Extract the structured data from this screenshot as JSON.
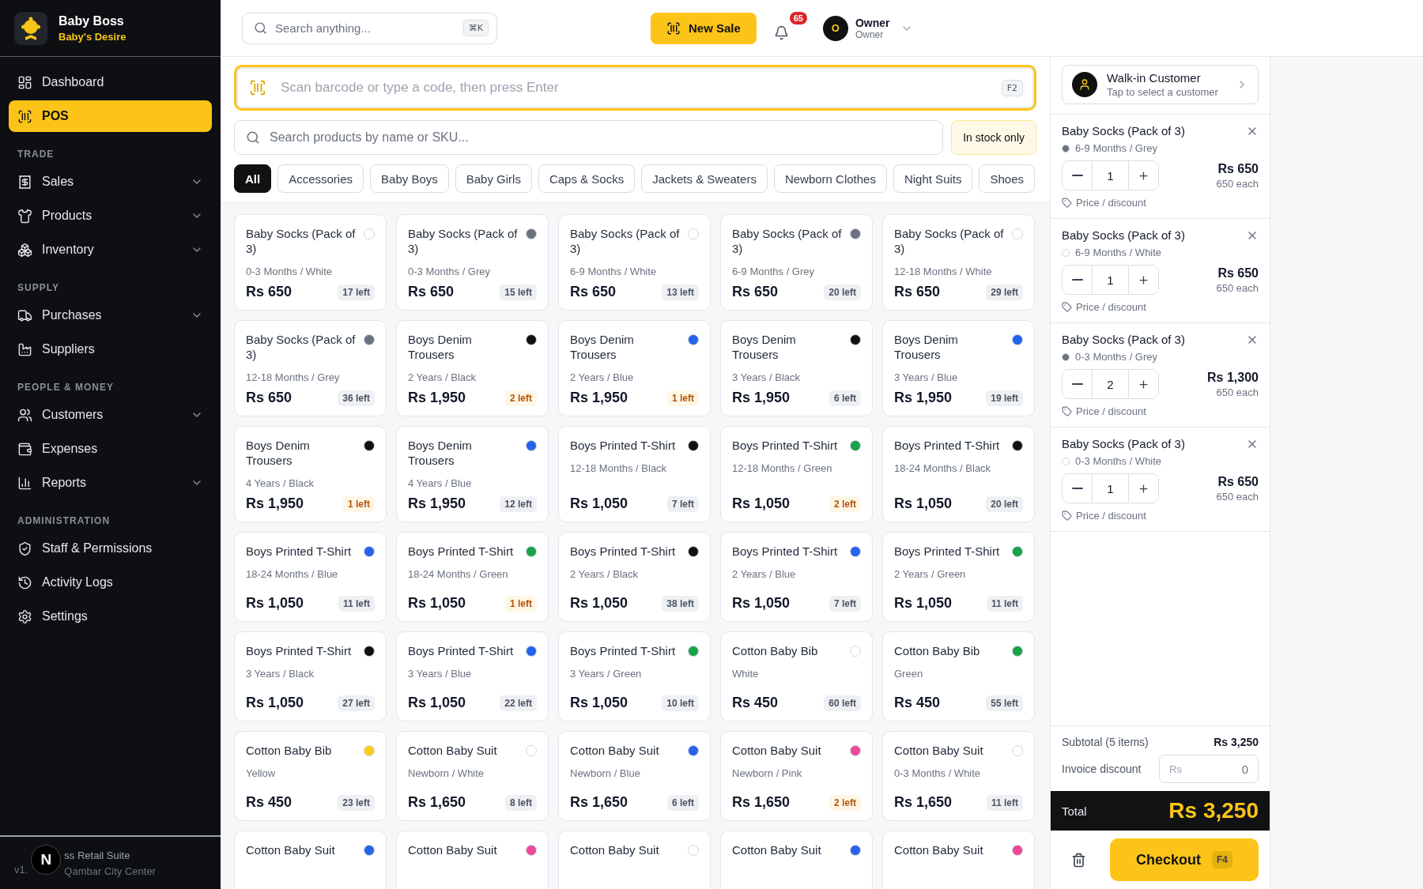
{
  "brand": {
    "name": "Baby Boss",
    "tagline": "Baby's Desire"
  },
  "nav": [
    {
      "items": [
        {
          "label": "Dashboard",
          "selected": false
        },
        {
          "label": "POS",
          "selected": true
        }
      ]
    },
    {
      "heading": "TRADE",
      "items": [
        {
          "label": "Sales",
          "selected": false,
          "expanded": false
        },
        {
          "label": "Products",
          "selected": false,
          "expanded": false
        },
        {
          "label": "Inventory",
          "selected": false,
          "expanded": false
        }
      ]
    },
    {
      "heading": "SUPPLY",
      "items": [
        {
          "label": "Purchases",
          "selected": false,
          "expanded": false
        },
        {
          "label": "Suppliers",
          "selected": false
        }
      ]
    },
    {
      "heading": "PEOPLE & MONEY",
      "items": [
        {
          "label": "Customers",
          "selected": false,
          "expanded": false
        },
        {
          "label": "Expenses",
          "selected": false
        },
        {
          "label": "Reports",
          "selected": false,
          "expanded": false
        }
      ]
    },
    {
      "heading": "ADMINISTRATION",
      "items": [
        {
          "label": "Staff & Permissions",
          "selected": false
        },
        {
          "label": "Activity Logs",
          "selected": false
        },
        {
          "label": "Settings",
          "selected": false
        }
      ]
    }
  ],
  "sidebar_footer": {
    "version": "v1.",
    "title": "ss Retail Suite",
    "subtitle": "Qambar City Center",
    "dev_badge": "N"
  },
  "header": {
    "search": {
      "placeholder": "Search anything...",
      "shortcut": "⌘K"
    },
    "new_sale": "New Sale",
    "notifications": "65",
    "user": {
      "initial": "O",
      "name": "Owner",
      "role": "Owner"
    }
  },
  "scan": {
    "placeholder": "Scan barcode or type a code, then press Enter",
    "shortcut": "F2"
  },
  "product_search": {
    "placeholder": "Search products by name or SKU..."
  },
  "stock_filter": {
    "label": "In stock only",
    "on": false
  },
  "categories": [
    {
      "label": "All",
      "selected": true
    },
    {
      "label": "Accessories",
      "selected": false
    },
    {
      "label": "Baby Boys",
      "selected": false
    },
    {
      "label": "Baby Girls",
      "selected": false
    },
    {
      "label": "Caps & Socks",
      "selected": false
    },
    {
      "label": "Jackets & Sweaters",
      "selected": false
    },
    {
      "label": "Newborn Clothes",
      "selected": false
    },
    {
      "label": "Night Suits",
      "selected": false
    },
    {
      "label": "Shoes",
      "selected": false
    }
  ],
  "products": [
    {
      "name": "Baby Socks (Pack of 3)",
      "variant": "0-3 Months / White",
      "price": "Rs 650",
      "stock": "17 left",
      "low": false,
      "color": "#ffffff"
    },
    {
      "name": "Baby Socks (Pack of 3)",
      "variant": "0-3 Months / Grey",
      "price": "Rs 650",
      "stock": "15 left",
      "low": false,
      "color": "#6b7280"
    },
    {
      "name": "Baby Socks (Pack of 3)",
      "variant": "6-9 Months / White",
      "price": "Rs 650",
      "stock": "13 left",
      "low": false,
      "color": "#ffffff"
    },
    {
      "name": "Baby Socks (Pack of 3)",
      "variant": "6-9 Months / Grey",
      "price": "Rs 650",
      "stock": "20 left",
      "low": false,
      "color": "#6b7280"
    },
    {
      "name": "Baby Socks (Pack of 3)",
      "variant": "12-18 Months / White",
      "price": "Rs 650",
      "stock": "29 left",
      "low": false,
      "color": "#ffffff"
    },
    {
      "name": "Baby Socks (Pack of 3)",
      "variant": "12-18 Months / Grey",
      "price": "Rs 650",
      "stock": "36 left",
      "low": false,
      "color": "#6b7280"
    },
    {
      "name": "Boys Denim Trousers",
      "variant": "2 Years / Black",
      "price": "Rs 1,950",
      "stock": "2 left",
      "low": true,
      "color": "#111111"
    },
    {
      "name": "Boys Denim Trousers",
      "variant": "2 Years / Blue",
      "price": "Rs 1,950",
      "stock": "1 left",
      "low": true,
      "color": "#2563eb"
    },
    {
      "name": "Boys Denim Trousers",
      "variant": "3 Years / Black",
      "price": "Rs 1,950",
      "stock": "6 left",
      "low": false,
      "color": "#111111"
    },
    {
      "name": "Boys Denim Trousers",
      "variant": "3 Years / Blue",
      "price": "Rs 1,950",
      "stock": "19 left",
      "low": false,
      "color": "#2563eb"
    },
    {
      "name": "Boys Denim Trousers",
      "variant": "4 Years / Black",
      "price": "Rs 1,950",
      "stock": "1 left",
      "low": true,
      "color": "#111111"
    },
    {
      "name": "Boys Denim Trousers",
      "variant": "4 Years / Blue",
      "price": "Rs 1,950",
      "stock": "12 left",
      "low": false,
      "color": "#2563eb"
    },
    {
      "name": "Boys Printed T-Shirt",
      "variant": "12-18 Months / Black",
      "price": "Rs 1,050",
      "stock": "7 left",
      "low": false,
      "color": "#111111"
    },
    {
      "name": "Boys Printed T-Shirt",
      "variant": "12-18 Months / Green",
      "price": "Rs 1,050",
      "stock": "2 left",
      "low": true,
      "color": "#16a34a"
    },
    {
      "name": "Boys Printed T-Shirt",
      "variant": "18-24 Months / Black",
      "price": "Rs 1,050",
      "stock": "20 left",
      "low": false,
      "color": "#111111"
    },
    {
      "name": "Boys Printed T-Shirt",
      "variant": "18-24 Months / Blue",
      "price": "Rs 1,050",
      "stock": "11 left",
      "low": false,
      "color": "#2563eb"
    },
    {
      "name": "Boys Printed T-Shirt",
      "variant": "18-24 Months / Green",
      "price": "Rs 1,050",
      "stock": "1 left",
      "low": true,
      "color": "#16a34a"
    },
    {
      "name": "Boys Printed T-Shirt",
      "variant": "2 Years / Black",
      "price": "Rs 1,050",
      "stock": "38 left",
      "low": false,
      "color": "#111111"
    },
    {
      "name": "Boys Printed T-Shirt",
      "variant": "2 Years / Blue",
      "price": "Rs 1,050",
      "stock": "7 left",
      "low": false,
      "color": "#2563eb"
    },
    {
      "name": "Boys Printed T-Shirt",
      "variant": "2 Years / Green",
      "price": "Rs 1,050",
      "stock": "11 left",
      "low": false,
      "color": "#16a34a"
    },
    {
      "name": "Boys Printed T-Shirt",
      "variant": "3 Years / Black",
      "price": "Rs 1,050",
      "stock": "27 left",
      "low": false,
      "color": "#111111"
    },
    {
      "name": "Boys Printed T-Shirt",
      "variant": "3 Years / Blue",
      "price": "Rs 1,050",
      "stock": "22 left",
      "low": false,
      "color": "#2563eb"
    },
    {
      "name": "Boys Printed T-Shirt",
      "variant": "3 Years / Green",
      "price": "Rs 1,050",
      "stock": "10 left",
      "low": false,
      "color": "#16a34a"
    },
    {
      "name": "Cotton Baby Bib",
      "variant": "White",
      "price": "Rs 450",
      "stock": "60 left",
      "low": false,
      "color": "#ffffff"
    },
    {
      "name": "Cotton Baby Bib",
      "variant": "Green",
      "price": "Rs 450",
      "stock": "55 left",
      "low": false,
      "color": "#16a34a"
    },
    {
      "name": "Cotton Baby Bib",
      "variant": "Yellow",
      "price": "Rs 450",
      "stock": "23 left",
      "low": false,
      "color": "#facc15"
    },
    {
      "name": "Cotton Baby Suit",
      "variant": "Newborn / White",
      "price": "Rs 1,650",
      "stock": "8 left",
      "low": false,
      "color": "#ffffff"
    },
    {
      "name": "Cotton Baby Suit",
      "variant": "Newborn / Blue",
      "price": "Rs 1,650",
      "stock": "6 left",
      "low": false,
      "color": "#2563eb"
    },
    {
      "name": "Cotton Baby Suit",
      "variant": "Newborn / Pink",
      "price": "Rs 1,650",
      "stock": "2 left",
      "low": true,
      "color": "#ec4899"
    },
    {
      "name": "Cotton Baby Suit",
      "variant": "0-3 Months / White",
      "price": "Rs 1,650",
      "stock": "11 left",
      "low": false,
      "color": "#ffffff"
    },
    {
      "name": "Cotton Baby Suit",
      "color": "#2563eb"
    },
    {
      "name": "Cotton Baby Suit",
      "color": "#ec4899"
    },
    {
      "name": "Cotton Baby Suit",
      "color": "#ffffff"
    },
    {
      "name": "Cotton Baby Suit",
      "color": "#2563eb"
    },
    {
      "name": "Cotton Baby Suit",
      "color": "#ec4899"
    }
  ],
  "customer": {
    "name": "Walk-in Customer",
    "hint": "Tap to select a customer"
  },
  "cart": [
    {
      "name": "Baby Socks (Pack of 3)",
      "variant": "6-9 Months / Grey",
      "color": "#6b7280",
      "qty": "1",
      "total": "Rs 650",
      "each": "650 each",
      "action": "Price / discount"
    },
    {
      "name": "Baby Socks (Pack of 3)",
      "variant": "6-9 Months / White",
      "color": "#ffffff",
      "qty": "1",
      "total": "Rs 650",
      "each": "650 each",
      "action": "Price / discount"
    },
    {
      "name": "Baby Socks (Pack of 3)",
      "variant": "0-3 Months / Grey",
      "color": "#6b7280",
      "qty": "2",
      "total": "Rs 1,300",
      "each": "650 each",
      "action": "Price / discount"
    },
    {
      "name": "Baby Socks (Pack of 3)",
      "variant": "0-3 Months / White",
      "color": "#ffffff",
      "qty": "1",
      "total": "Rs 650",
      "each": "650 each",
      "action": "Price / discount"
    }
  ],
  "summary": {
    "subtotal_label": "Subtotal (5 items)",
    "subtotal": "Rs 3,250",
    "discount_label": "Invoice discount",
    "discount_prefix": "Rs",
    "discount_value": "0",
    "total_label": "Total",
    "total": "Rs 3,250",
    "checkout": "Checkout",
    "checkout_shortcut": "F4"
  }
}
